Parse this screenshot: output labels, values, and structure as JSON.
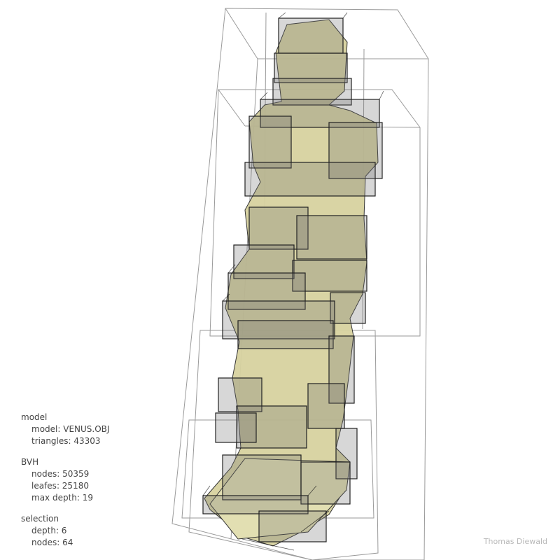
{
  "sections": {
    "model": {
      "title": "model",
      "model_label": "model",
      "model_value": "VENUS.OBJ",
      "triangles_label": "triangles",
      "triangles_value": "43303"
    },
    "bvh": {
      "title": "BVH",
      "nodes_label": "nodes",
      "nodes_value": "50359",
      "leafes_label": "leafes",
      "leafes_value": "25180",
      "max_depth_label": "max depth",
      "max_depth_value": "19"
    },
    "selection": {
      "title": "selection",
      "depth_label": "depth",
      "depth_value": "6",
      "nodes_label": "nodes",
      "nodes_value": "64"
    }
  },
  "credit": "Thomas Diewald",
  "colors": {
    "background": "#ffffff",
    "statue_fill": "#d7d2a0",
    "box_fill": "#6f6f6f",
    "box_stroke": "#222222",
    "outer_box_stroke": "#9a9a9a",
    "text": "#444444",
    "credit_text": "#b8b8b8"
  }
}
